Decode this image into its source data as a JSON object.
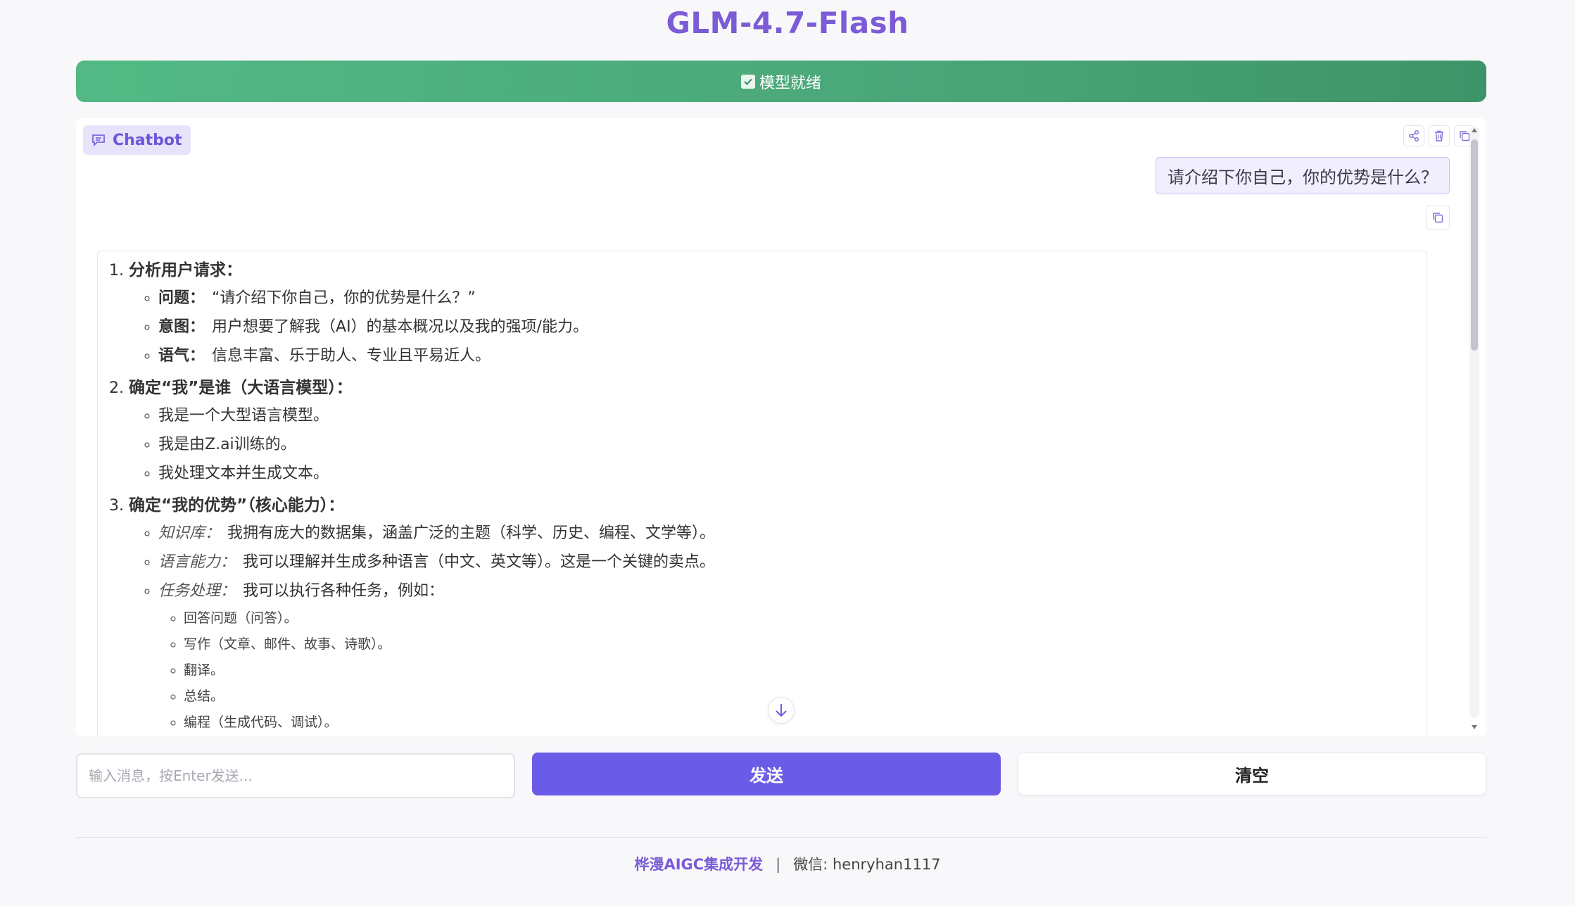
{
  "app": {
    "title": "GLM-4.7-Flash"
  },
  "status": {
    "text": "模型就绪"
  },
  "chat": {
    "label": "Chatbot",
    "user_message": "请介绍下你自己，你的优势是什么？",
    "sections": [
      {
        "title": "分析用户请求：",
        "items": [
          {
            "key": "问题：",
            "text": "“请介绍下你自己，你的优势是什么？”"
          },
          {
            "key": "意图：",
            "text": "用户想要了解我（AI）的基本概况以及我的强项/能力。"
          },
          {
            "key": "语气：",
            "text": "信息丰富、乐于助人、专业且平易近人。"
          }
        ]
      },
      {
        "title": "确定“我”是谁（大语言模型）：",
        "items": [
          {
            "text": "我是一个大型语言模型。"
          },
          {
            "text": "我是由Z.ai训练的。"
          },
          {
            "text": "我处理文本并生成文本。"
          }
        ]
      },
      {
        "title": "确定“我的优势”（核心能力）：",
        "items": [
          {
            "key": "知识库：",
            "text": "我拥有庞大的数据集，涵盖广泛的主题（科学、历史、编程、文学等）。"
          },
          {
            "key": "语言能力：",
            "text": "我可以理解并生成多种语言（中文、英文等）。这是一个关键的卖点。"
          },
          {
            "key": "任务处理：",
            "text": "我可以执行各种任务，例如："
          }
        ],
        "subitems": [
          "回答问题（问答）。",
          "写作（文章、邮件、故事、诗歌）。",
          "翻译。",
          "总结。",
          "编程（生成代码、调试）。"
        ]
      }
    ]
  },
  "input": {
    "placeholder": "输入消息，按Enter发送..."
  },
  "buttons": {
    "send": "发送",
    "clear": "清空"
  },
  "footer": {
    "brand": "桦漫AIGC集成开发",
    "separator": "|",
    "contact": "微信: henryhan1117"
  },
  "colors": {
    "accent": "#6b5ce7",
    "title": "#7b5bd6",
    "success": "#4aa678"
  }
}
